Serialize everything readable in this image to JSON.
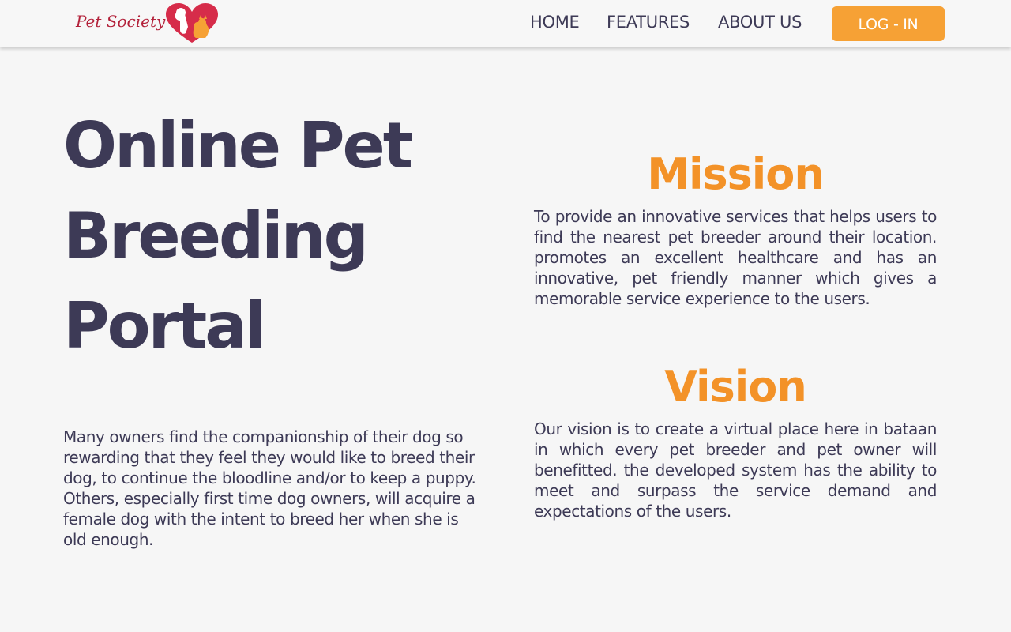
{
  "brand": {
    "name": "Pet Society",
    "logo_color": "#b3213a",
    "accent": "#f6a135"
  },
  "nav": {
    "items": [
      {
        "label": "HOME"
      },
      {
        "label": "FEATURES"
      },
      {
        "label": "ABOUT US"
      }
    ],
    "login_label": "LOG - IN"
  },
  "hero": {
    "title": "Online Pet Breeding Portal",
    "description": "Many owners find the companionship of their dog so rewarding that they feel they would like to breed their dog, to continue the bloodline and/or to keep a puppy. Others, especially first time dog owners, will acquire a female dog with the intent to breed her when she is old enough."
  },
  "mission": {
    "title": "Mission",
    "text": "To provide an innovative services that helps users to find the nearest pet breeder around their location. promotes an excellent healthcare and has an innovative, pet friendly manner which gives a memorable service experience to the users."
  },
  "vision": {
    "title": "Vision",
    "text": "Our vision is to create a virtual place here in bataan in which every pet breeder and pet owner will benefitted. the developed system has the ability to meet and surpass the service demand and expectations of the users."
  },
  "colors": {
    "heading": "#3d3a56",
    "section_heading": "#f39228",
    "background": "#f6f6f6"
  }
}
